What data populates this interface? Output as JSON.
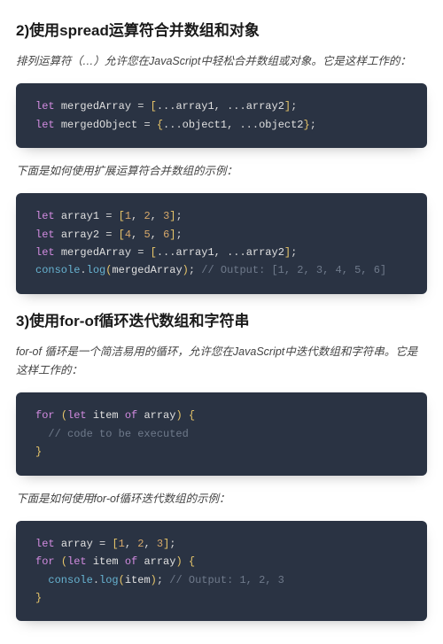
{
  "sections": [
    {
      "heading": "2)使用spread运算符合并数组和对象",
      "intro": "排列运算符（…）允许您在JavaScript中轻松合并数组或对象。它是这样工作的：",
      "code1_tokens": [
        [
          "kw",
          "let"
        ],
        [
          "sp",
          " "
        ],
        [
          "var",
          "mergedArray"
        ],
        [
          "sp",
          " "
        ],
        [
          "op",
          "="
        ],
        [
          "sp",
          " "
        ],
        [
          "brkt",
          "["
        ],
        [
          "spread",
          "..."
        ],
        [
          "var",
          "array1"
        ],
        [
          "punc",
          ","
        ],
        [
          "sp",
          " "
        ],
        [
          "spread",
          "..."
        ],
        [
          "var",
          "array2"
        ],
        [
          "brkt",
          "]"
        ],
        [
          "punc",
          ";"
        ],
        [
          "nl"
        ],
        [
          "kw",
          "let"
        ],
        [
          "sp",
          " "
        ],
        [
          "var",
          "mergedObject"
        ],
        [
          "sp",
          " "
        ],
        [
          "op",
          "="
        ],
        [
          "sp",
          " "
        ],
        [
          "brkt",
          "{"
        ],
        [
          "spread",
          "..."
        ],
        [
          "var",
          "object1"
        ],
        [
          "punc",
          ","
        ],
        [
          "sp",
          " "
        ],
        [
          "spread",
          "..."
        ],
        [
          "var",
          "object2"
        ],
        [
          "brkt",
          "}"
        ],
        [
          "punc",
          ";"
        ]
      ],
      "mid": "下面是如何使用扩展运算符合并数组的示例：",
      "code2_tokens": [
        [
          "kw",
          "let"
        ],
        [
          "sp",
          " "
        ],
        [
          "var",
          "array1"
        ],
        [
          "sp",
          " "
        ],
        [
          "op",
          "="
        ],
        [
          "sp",
          " "
        ],
        [
          "brkt",
          "["
        ],
        [
          "num",
          "1"
        ],
        [
          "punc",
          ","
        ],
        [
          "sp",
          " "
        ],
        [
          "num",
          "2"
        ],
        [
          "punc",
          ","
        ],
        [
          "sp",
          " "
        ],
        [
          "num",
          "3"
        ],
        [
          "brkt",
          "]"
        ],
        [
          "punc",
          ";"
        ],
        [
          "nl"
        ],
        [
          "kw",
          "let"
        ],
        [
          "sp",
          " "
        ],
        [
          "var",
          "array2"
        ],
        [
          "sp",
          " "
        ],
        [
          "op",
          "="
        ],
        [
          "sp",
          " "
        ],
        [
          "brkt",
          "["
        ],
        [
          "num",
          "4"
        ],
        [
          "punc",
          ","
        ],
        [
          "sp",
          " "
        ],
        [
          "num",
          "5"
        ],
        [
          "punc",
          ","
        ],
        [
          "sp",
          " "
        ],
        [
          "num",
          "6"
        ],
        [
          "brkt",
          "]"
        ],
        [
          "punc",
          ";"
        ],
        [
          "nl"
        ],
        [
          "kw",
          "let"
        ],
        [
          "sp",
          " "
        ],
        [
          "var",
          "mergedArray"
        ],
        [
          "sp",
          " "
        ],
        [
          "op",
          "="
        ],
        [
          "sp",
          " "
        ],
        [
          "brkt",
          "["
        ],
        [
          "spread",
          "..."
        ],
        [
          "var",
          "array1"
        ],
        [
          "punc",
          ","
        ],
        [
          "sp",
          " "
        ],
        [
          "spread",
          "..."
        ],
        [
          "var",
          "array2"
        ],
        [
          "brkt",
          "]"
        ],
        [
          "punc",
          ";"
        ],
        [
          "nl"
        ],
        [
          "fn",
          "console"
        ],
        [
          "punc",
          "."
        ],
        [
          "fn",
          "log"
        ],
        [
          "brkt",
          "("
        ],
        [
          "var",
          "mergedArray"
        ],
        [
          "brkt",
          ")"
        ],
        [
          "punc",
          ";"
        ],
        [
          "sp",
          " "
        ],
        [
          "cmt",
          "// Output: [1, 2, 3, 4, 5, 6]"
        ]
      ]
    },
    {
      "heading": "3)使用for-of循环迭代数组和字符串",
      "intro": "for-of 循环是一个简洁易用的循环，允许您在JavaScript中迭代数组和字符串。它是这样工作的：",
      "code1_tokens": [
        [
          "kw",
          "for"
        ],
        [
          "sp",
          " "
        ],
        [
          "brkt",
          "("
        ],
        [
          "kw",
          "let"
        ],
        [
          "sp",
          " "
        ],
        [
          "var",
          "item"
        ],
        [
          "sp",
          " "
        ],
        [
          "kw",
          "of"
        ],
        [
          "sp",
          " "
        ],
        [
          "var",
          "array"
        ],
        [
          "brkt",
          ")"
        ],
        [
          "sp",
          " "
        ],
        [
          "brkt",
          "{"
        ],
        [
          "nl"
        ],
        [
          "sp",
          "  "
        ],
        [
          "cmt",
          "// code to be executed"
        ],
        [
          "nl"
        ],
        [
          "brkt",
          "}"
        ]
      ],
      "mid": "下面是如何使用for-of循环迭代数组的示例：",
      "code2_tokens": [
        [
          "kw",
          "let"
        ],
        [
          "sp",
          " "
        ],
        [
          "var",
          "array"
        ],
        [
          "sp",
          " "
        ],
        [
          "op",
          "="
        ],
        [
          "sp",
          " "
        ],
        [
          "brkt",
          "["
        ],
        [
          "num",
          "1"
        ],
        [
          "punc",
          ","
        ],
        [
          "sp",
          " "
        ],
        [
          "num",
          "2"
        ],
        [
          "punc",
          ","
        ],
        [
          "sp",
          " "
        ],
        [
          "num",
          "3"
        ],
        [
          "brkt",
          "]"
        ],
        [
          "punc",
          ";"
        ],
        [
          "nl"
        ],
        [
          "kw",
          "for"
        ],
        [
          "sp",
          " "
        ],
        [
          "brkt",
          "("
        ],
        [
          "kw",
          "let"
        ],
        [
          "sp",
          " "
        ],
        [
          "var",
          "item"
        ],
        [
          "sp",
          " "
        ],
        [
          "kw",
          "of"
        ],
        [
          "sp",
          " "
        ],
        [
          "var",
          "array"
        ],
        [
          "brkt",
          ")"
        ],
        [
          "sp",
          " "
        ],
        [
          "brkt",
          "{"
        ],
        [
          "nl"
        ],
        [
          "sp",
          "  "
        ],
        [
          "fn",
          "console"
        ],
        [
          "punc",
          "."
        ],
        [
          "fn",
          "log"
        ],
        [
          "brkt",
          "("
        ],
        [
          "var",
          "item"
        ],
        [
          "brkt",
          ")"
        ],
        [
          "punc",
          ";"
        ],
        [
          "sp",
          " "
        ],
        [
          "cmt",
          "// Output: 1, 2, 3"
        ],
        [
          "nl"
        ],
        [
          "brkt",
          "}"
        ]
      ]
    }
  ]
}
